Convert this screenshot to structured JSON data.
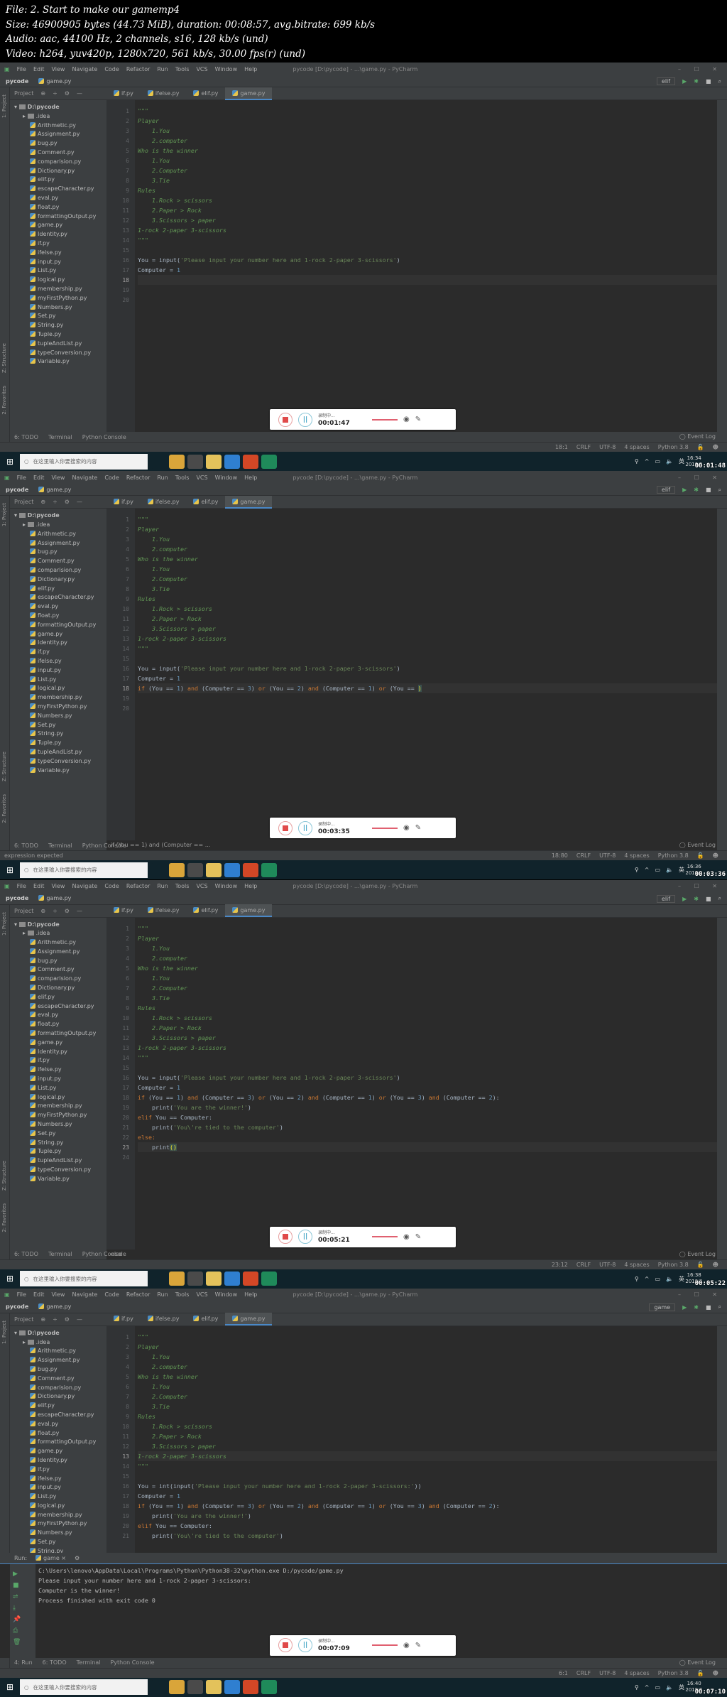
{
  "header": {
    "file": "File: 2. Start to make our gamemp4",
    "size": "Size: 46900905 bytes (44.73 MiB), duration: 00:08:57, avg.bitrate: 699 kb/s",
    "audio": "Audio: aac, 44100 Hz, 2 channels, s16, 128 kb/s (und)",
    "video": "Video: h264, yuv420p, 1280x720, 561 kb/s, 30.00 fps(r) (und)"
  },
  "ide": {
    "menu": [
      "File",
      "Edit",
      "View",
      "Navigate",
      "Code",
      "Refactor",
      "Run",
      "Tools",
      "VCS",
      "Window",
      "Help"
    ],
    "window_title": "pycode [D:\\pycode] - ...\\game.py - PyCharm",
    "window_controls": "– ☐ ✕",
    "nav_project": "pycode",
    "nav_file": "game.py",
    "run_config": "elif",
    "project_label": "Project",
    "project_side_label": "1: Project",
    "structure_label": "Z: Structure",
    "favorites_label": "2: Favorites",
    "tabs": [
      "if.py",
      "ifelse.py",
      "elif.py",
      "game.py"
    ],
    "tree_root": "D:\\pycode",
    "tree_idea": ".idea",
    "files": [
      "Arithmetic.py",
      "Assignment.py",
      "bug.py",
      "Comment.py",
      "comparision.py",
      "Dictionary.py",
      "elif.py",
      "escapeCharacter.py",
      "eval.py",
      "float.py",
      "formattingOutput.py",
      "game.py",
      "Identity.py",
      "if.py",
      "ifelse.py",
      "input.py",
      "List.py",
      "logical.py",
      "membership.py",
      "myFirstPython.py",
      "Numbers.py",
      "Set.py",
      "String.py",
      "Tuple.py",
      "tupleAndList.py",
      "typeConversion.py",
      "Variable.py"
    ],
    "tooltabs": [
      "6: TODO",
      "Terminal",
      "Python Console"
    ],
    "tooltabs_run": [
      "4: Run",
      "6: TODO",
      "Terminal",
      "Python Console"
    ],
    "event_log": "Event Log",
    "status_right": [
      "CRLF",
      "UTF-8",
      "4 spaces",
      "Python 3.8"
    ]
  },
  "taskbar": {
    "search_placeholder": "在这里输入你要搜索的内容",
    "lang": "英",
    "date": "2019/1"
  },
  "recorder": {
    "status": "录制中..."
  },
  "frames": [
    {
      "video_time": "00:01:48",
      "rec_time": "00:01:47",
      "clock": "16:34",
      "cursor": "18:1",
      "current_line": 18,
      "breadcrumb": "",
      "status_msg": "",
      "lines": [
        [
          [
            "doc",
            "\"\"\""
          ]
        ],
        [
          [
            "doc",
            "Player"
          ]
        ],
        [
          [
            "doc",
            "    1.You"
          ]
        ],
        [
          [
            "doc",
            "    2.computer"
          ]
        ],
        [
          [
            "doc",
            "Who is the winner"
          ]
        ],
        [
          [
            "doc",
            "    1.You"
          ]
        ],
        [
          [
            "doc",
            "    2.Computer"
          ]
        ],
        [
          [
            "doc",
            "    3.Tie"
          ]
        ],
        [
          [
            "doc",
            "Rules"
          ]
        ],
        [
          [
            "doc",
            "    1.Rock > scissors"
          ]
        ],
        [
          [
            "doc",
            "    2.Paper > Rock"
          ]
        ],
        [
          [
            "doc",
            "    3.Scissors > paper"
          ]
        ],
        [
          [
            "doc",
            "1-rock 2-paper 3-scissors"
          ]
        ],
        [
          [
            "doc",
            "\"\"\""
          ]
        ],
        [],
        [
          [
            "fn",
            "You = input("
          ],
          [
            "str",
            "'Please input your number here and 1-rock 2-paper 3-scissors'"
          ],
          [
            "fn",
            ")"
          ]
        ],
        [
          [
            "fn",
            "Computer = "
          ],
          [
            "num",
            "1"
          ]
        ],
        [],
        [],
        []
      ]
    },
    {
      "video_time": "00:03:36",
      "rec_time": "00:03:35",
      "clock": "16:36",
      "cursor": "18:80",
      "current_line": 18,
      "breadcrumb": "if (You == 1) and (Computer == ...",
      "status_msg": "expression expected",
      "lines": [
        [
          [
            "doc",
            "\"\"\""
          ]
        ],
        [
          [
            "doc",
            "Player"
          ]
        ],
        [
          [
            "doc",
            "    1.You"
          ]
        ],
        [
          [
            "doc",
            "    2.computer"
          ]
        ],
        [
          [
            "doc",
            "Who is the winner"
          ]
        ],
        [
          [
            "doc",
            "    1.You"
          ]
        ],
        [
          [
            "doc",
            "    2.Computer"
          ]
        ],
        [
          [
            "doc",
            "    3.Tie"
          ]
        ],
        [
          [
            "doc",
            "Rules"
          ]
        ],
        [
          [
            "doc",
            "    1.Rock > scissors"
          ]
        ],
        [
          [
            "doc",
            "    2.Paper > Rock"
          ]
        ],
        [
          [
            "doc",
            "    3.Scissors > paper"
          ]
        ],
        [
          [
            "doc",
            "1-rock 2-paper 3-scissors"
          ]
        ],
        [
          [
            "doc",
            "\"\"\""
          ]
        ],
        [],
        [
          [
            "fn",
            "You = input("
          ],
          [
            "str",
            "'Please input your number here and 1-rock 2-paper 3-scissors'"
          ],
          [
            "fn",
            ")"
          ]
        ],
        [
          [
            "fn",
            "Computer = "
          ],
          [
            "num",
            "1"
          ]
        ],
        [
          [
            "kw",
            "if "
          ],
          [
            "fn",
            "(You == "
          ],
          [
            "num",
            "1"
          ],
          [
            "fn",
            ") "
          ],
          [
            "kw",
            "and "
          ],
          [
            "fn",
            "(Computer == "
          ],
          [
            "num",
            "3"
          ],
          [
            "fn",
            ") "
          ],
          [
            "kw",
            "or "
          ],
          [
            "fn",
            "(You == "
          ],
          [
            "num",
            "2"
          ],
          [
            "fn",
            ") "
          ],
          [
            "kw",
            "and "
          ],
          [
            "fn",
            "(Computer == "
          ],
          [
            "num",
            "1"
          ],
          [
            "fn",
            ") "
          ],
          [
            "kw",
            "or "
          ],
          [
            "fn",
            "(You == "
          ],
          [
            "br",
            ")"
          ]
        ],
        [],
        []
      ]
    },
    {
      "video_time": "00:05:22",
      "rec_time": "00:05:21",
      "clock": "16:38",
      "cursor": "23:12",
      "current_line": 23,
      "breadcrumb": "else",
      "status_msg": "",
      "lines": [
        [
          [
            "doc",
            "\"\"\""
          ]
        ],
        [
          [
            "doc",
            "Player"
          ]
        ],
        [
          [
            "doc",
            "    1.You"
          ]
        ],
        [
          [
            "doc",
            "    2.computer"
          ]
        ],
        [
          [
            "doc",
            "Who is the winner"
          ]
        ],
        [
          [
            "doc",
            "    1.You"
          ]
        ],
        [
          [
            "doc",
            "    2.Computer"
          ]
        ],
        [
          [
            "doc",
            "    3.Tie"
          ]
        ],
        [
          [
            "doc",
            "Rules"
          ]
        ],
        [
          [
            "doc",
            "    1.Rock > scissors"
          ]
        ],
        [
          [
            "doc",
            "    2.Paper > Rock"
          ]
        ],
        [
          [
            "doc",
            "    3.Scissors > paper"
          ]
        ],
        [
          [
            "doc",
            "1-rock 2-paper 3-scissors"
          ]
        ],
        [
          [
            "doc",
            "\"\"\""
          ]
        ],
        [],
        [
          [
            "fn",
            "You = input("
          ],
          [
            "str",
            "'Please input your number here and 1-rock 2-paper 3-scissors'"
          ],
          [
            "fn",
            ")"
          ]
        ],
        [
          [
            "fn",
            "Computer = "
          ],
          [
            "num",
            "1"
          ]
        ],
        [
          [
            "kw",
            "if "
          ],
          [
            "fn",
            "(You == "
          ],
          [
            "num",
            "1"
          ],
          [
            "fn",
            ") "
          ],
          [
            "kw",
            "and "
          ],
          [
            "fn",
            "(Computer == "
          ],
          [
            "num",
            "3"
          ],
          [
            "fn",
            ") "
          ],
          [
            "kw",
            "or "
          ],
          [
            "fn",
            "(You == "
          ],
          [
            "num",
            "2"
          ],
          [
            "fn",
            ") "
          ],
          [
            "kw",
            "and "
          ],
          [
            "fn",
            "(Computer == "
          ],
          [
            "num",
            "1"
          ],
          [
            "fn",
            ") "
          ],
          [
            "kw",
            "or "
          ],
          [
            "fn",
            "(You == "
          ],
          [
            "num",
            "3"
          ],
          [
            "fn",
            ") "
          ],
          [
            "kw",
            "and "
          ],
          [
            "fn",
            "(Computer == "
          ],
          [
            "num",
            "2"
          ],
          [
            "fn",
            "):"
          ]
        ],
        [
          [
            "fn",
            "    print("
          ],
          [
            "str",
            "'You are the winner!'"
          ],
          [
            "fn",
            ")"
          ]
        ],
        [
          [
            "kw",
            "elif "
          ],
          [
            "fn",
            "You == Computer:"
          ]
        ],
        [
          [
            "fn",
            "    print("
          ],
          [
            "str",
            "'You\\'re tied to the computer'"
          ],
          [
            "fn",
            ")"
          ]
        ],
        [
          [
            "kw",
            "else:"
          ]
        ],
        [
          [
            "fn",
            "    print"
          ],
          [
            "br",
            "()"
          ]
        ],
        []
      ]
    },
    {
      "video_time": "00:07:10",
      "rec_time": "00:07:09",
      "clock": "16:40",
      "cursor": "6:1",
      "current_line": 13,
      "breadcrumb": "",
      "status_msg": "",
      "run_config": "game",
      "lines": [
        [
          [
            "doc",
            "\"\"\""
          ]
        ],
        [
          [
            "doc",
            "Player"
          ]
        ],
        [
          [
            "doc",
            "    1.You"
          ]
        ],
        [
          [
            "doc",
            "    2.computer"
          ]
        ],
        [
          [
            "doc",
            "Who is the winner"
          ]
        ],
        [
          [
            "doc",
            "    1.You"
          ]
        ],
        [
          [
            "doc",
            "    2.Computer"
          ]
        ],
        [
          [
            "doc",
            "    3.Tie"
          ]
        ],
        [
          [
            "doc",
            "Rules"
          ]
        ],
        [
          [
            "doc",
            "    1.Rock > scissors"
          ]
        ],
        [
          [
            "doc",
            "    2.Paper > Rock"
          ]
        ],
        [
          [
            "doc",
            "    3.Scissors > paper"
          ]
        ],
        [
          [
            "doc",
            "1-rock 2-paper 3-scissors"
          ]
        ],
        [
          [
            "doc",
            "\"\"\""
          ]
        ],
        [],
        [
          [
            "fn",
            "You = int(input("
          ],
          [
            "str",
            "'Please input your number here and 1-rock 2-paper 3-scissors:'"
          ],
          [
            "fn",
            "))"
          ]
        ],
        [
          [
            "fn",
            "Computer = "
          ],
          [
            "num",
            "1"
          ]
        ],
        [
          [
            "kw",
            "if "
          ],
          [
            "fn",
            "(You == "
          ],
          [
            "num",
            "1"
          ],
          [
            "fn",
            ") "
          ],
          [
            "kw",
            "and "
          ],
          [
            "fn",
            "(Computer == "
          ],
          [
            "num",
            "3"
          ],
          [
            "fn",
            ") "
          ],
          [
            "kw",
            "or "
          ],
          [
            "fn",
            "(You == "
          ],
          [
            "num",
            "2"
          ],
          [
            "fn",
            ") "
          ],
          [
            "kw",
            "and "
          ],
          [
            "fn",
            "(Computer == "
          ],
          [
            "num",
            "1"
          ],
          [
            "fn",
            ") "
          ],
          [
            "kw",
            "or "
          ],
          [
            "fn",
            "(You == "
          ],
          [
            "num",
            "3"
          ],
          [
            "fn",
            ") "
          ],
          [
            "kw",
            "and "
          ],
          [
            "fn",
            "(Computer == "
          ],
          [
            "num",
            "2"
          ],
          [
            "fn",
            "):"
          ]
        ],
        [
          [
            "fn",
            "    print("
          ],
          [
            "str",
            "'You are the winner!'"
          ],
          [
            "fn",
            ")"
          ]
        ],
        [
          [
            "kw",
            "elif "
          ],
          [
            "fn",
            "You == Computer:"
          ]
        ],
        [
          [
            "fn",
            "    print("
          ],
          [
            "str",
            "'You\\'re tied to the computer'"
          ],
          [
            "fn",
            ")"
          ]
        ]
      ],
      "run": {
        "label": "Run:",
        "tab": "game",
        "console": [
          "C:\\Users\\lenovo\\AppData\\Local\\Programs\\Python\\Python38-32\\python.exe D:/pycode/game.py",
          "Please input your number here and 1-rock 2-paper 3-scissors:",
          "Computer is the winner!",
          "",
          "Process finished with exit code 0"
        ]
      }
    }
  ]
}
